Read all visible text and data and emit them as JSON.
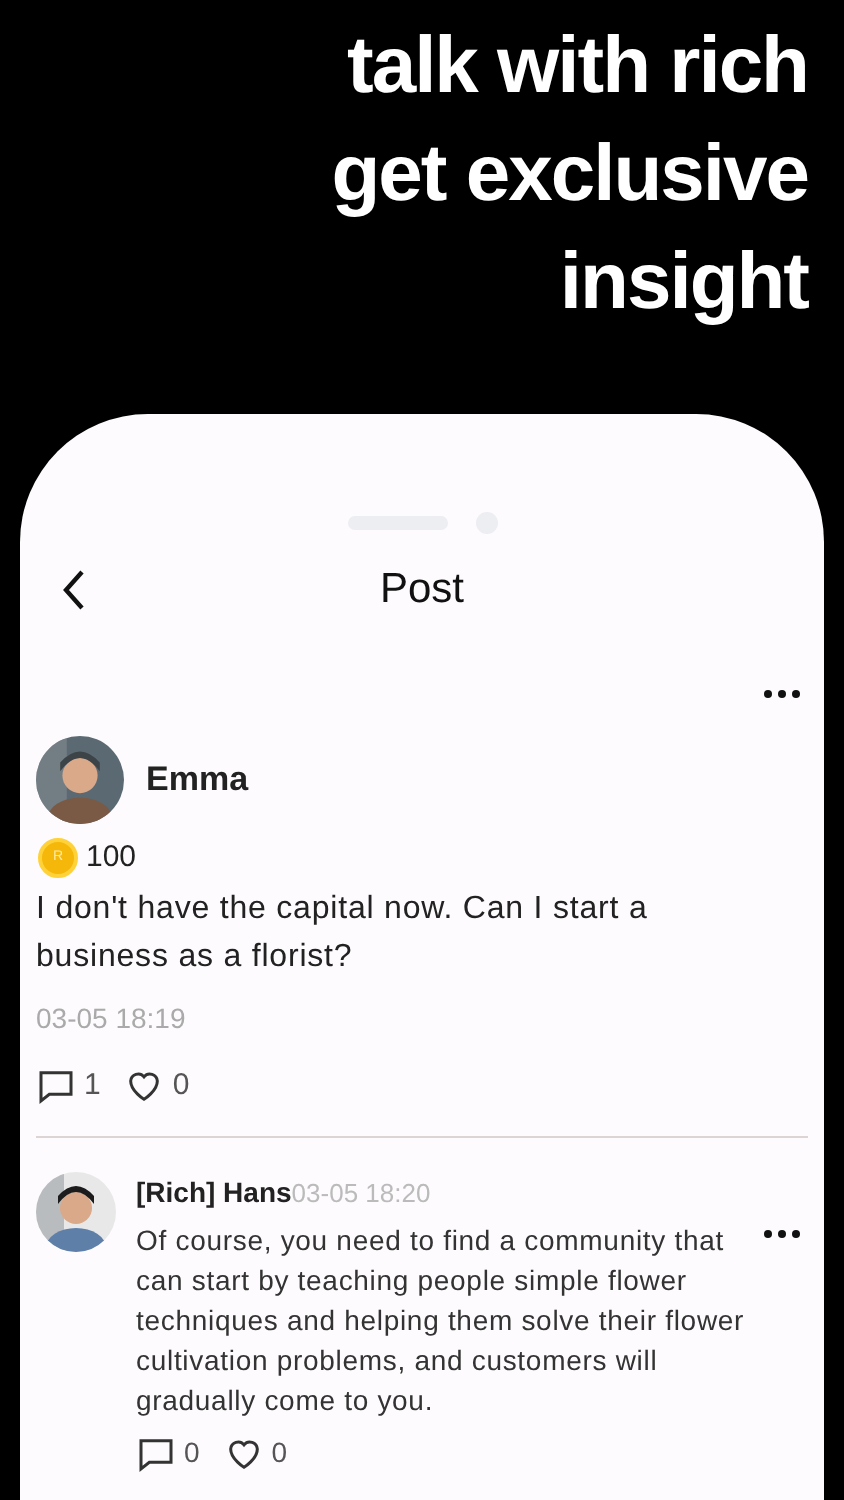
{
  "headline": [
    "talk with rich",
    "get exclusive",
    "insight"
  ],
  "nav": {
    "title": "Post"
  },
  "post": {
    "author": "Emma",
    "coin_letter": "R",
    "coins": "100",
    "text": "I don't have the capital now. Can I start a business as a florist?",
    "time": "03-05 18:19",
    "comments": "1",
    "likes": "0"
  },
  "replies": [
    {
      "author": "[Rich] Hans",
      "time": "03-05 18:20",
      "text": "Of course, you need to find a community that can start by teaching people simple flower techniques and helping them solve their flower cultivation problems, and customers will gradually come to you.",
      "comments": "0",
      "likes": "0"
    }
  ]
}
